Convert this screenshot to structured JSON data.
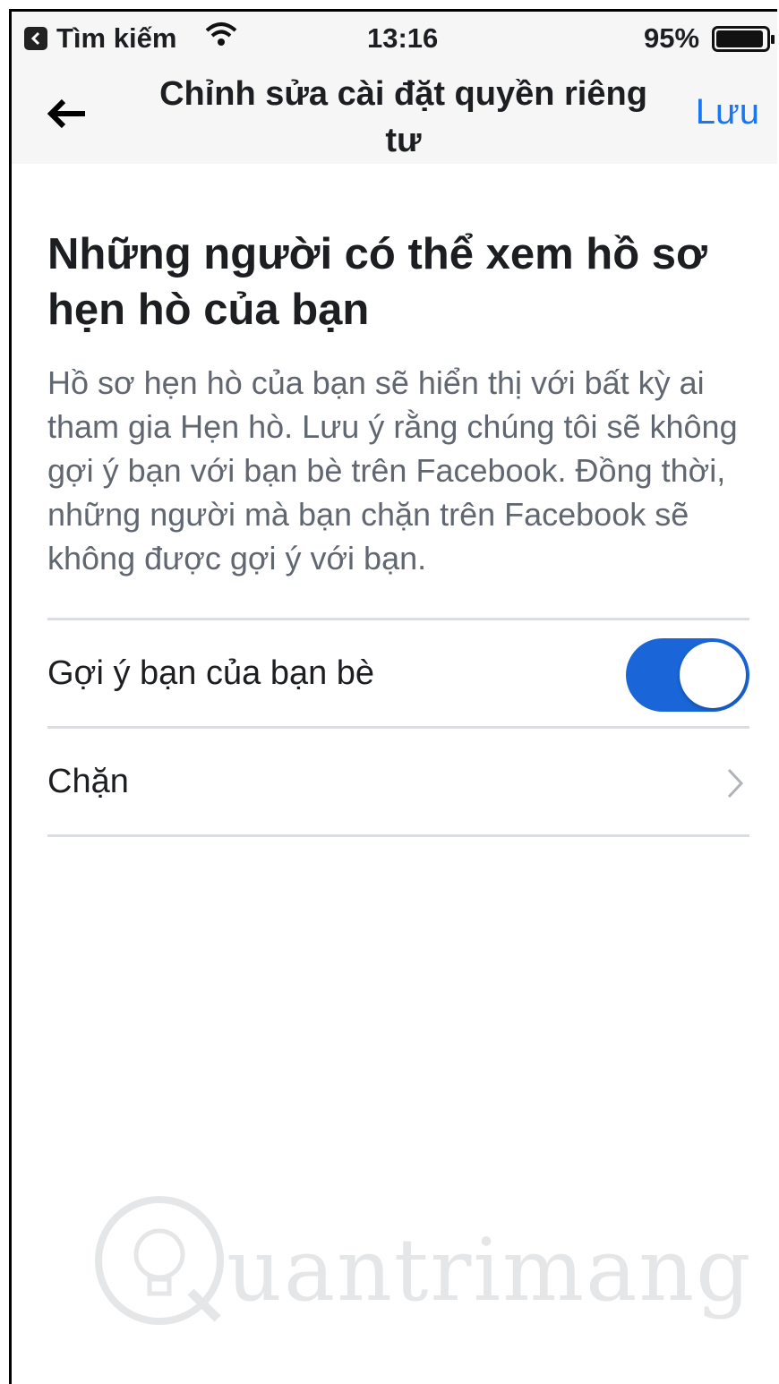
{
  "status_bar": {
    "back_app_label": "Tìm kiếm",
    "time": "13:16",
    "battery_percent": "95%",
    "battery_level": 0.95
  },
  "nav": {
    "title": "Chỉnh sửa cài đặt quyền riêng tư",
    "save_label": "Lưu",
    "back_icon": "arrow-left-icon"
  },
  "section": {
    "heading": "Những người có thể xem hồ sơ hẹn hò của bạn",
    "description": "Hồ sơ hẹn hò của bạn sẽ hiển thị với bất kỳ ai tham gia Hẹn hò. Lưu ý rằng chúng tôi sẽ không gợi ý bạn với bạn bè trên Facebook. Đồng thời, những người mà bạn chặn trên Facebook sẽ không được gợi ý với bạn."
  },
  "settings": {
    "friends_of_friends_label": "Gợi ý bạn của bạn bè",
    "friends_of_friends_on": true,
    "block_label": "Chặn"
  },
  "watermark": {
    "text": "uantrimang"
  },
  "colors": {
    "accent": "#1877f2",
    "toggle_on": "#1a66d9",
    "secondary_text": "#606770"
  }
}
